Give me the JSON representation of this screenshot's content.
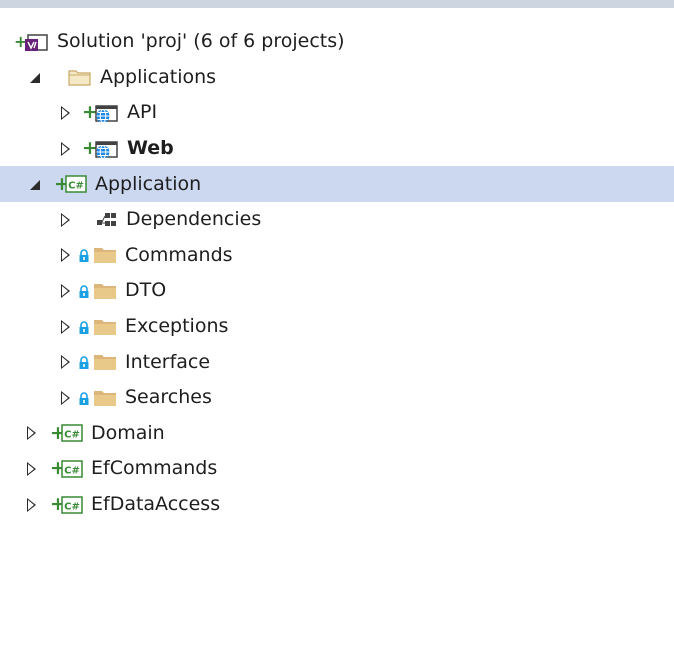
{
  "tree": {
    "solution": {
      "label": "Solution 'proj' (6 of 6 projects)",
      "icon": "vs-solution-icon"
    },
    "items": [
      {
        "label": "Applications",
        "icon": "solution-folder-icon",
        "expanded": true
      },
      {
        "label": "API",
        "icon": "web-project-icon"
      },
      {
        "label": "Web",
        "icon": "web-project-icon",
        "bold": true
      },
      {
        "label": "Application",
        "icon": "csharp-project-icon",
        "expanded": true,
        "selected": true
      },
      {
        "label": "Dependencies",
        "icon": "dependencies-icon"
      },
      {
        "label": "Commands",
        "icon": "folder-icon"
      },
      {
        "label": "DTO",
        "icon": "folder-icon"
      },
      {
        "label": "Exceptions",
        "icon": "folder-icon"
      },
      {
        "label": "Interface",
        "icon": "folder-icon"
      },
      {
        "label": "Searches",
        "icon": "folder-icon"
      },
      {
        "label": "Domain",
        "icon": "csharp-project-icon"
      },
      {
        "label": "EfCommands",
        "icon": "csharp-project-icon"
      },
      {
        "label": "EfDataAccess",
        "icon": "csharp-project-icon"
      }
    ]
  },
  "colors": {
    "selection": "#ccd8f0",
    "plus_green": "#388a34",
    "folder_yellow": "#dcb67a",
    "vs_purple": "#68217a",
    "lock_blue": "#1ba1e2"
  }
}
